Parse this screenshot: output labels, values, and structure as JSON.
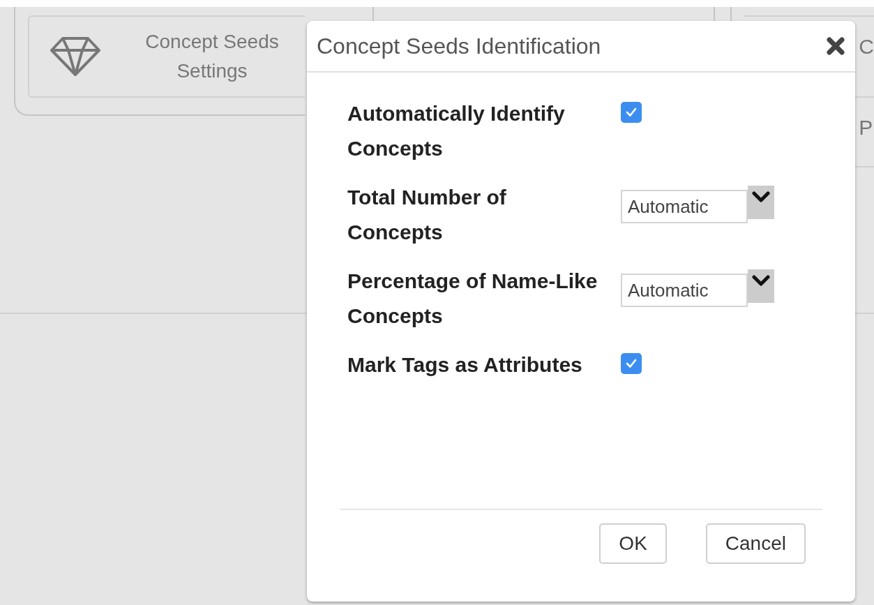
{
  "background": {
    "tile": {
      "label": "Concept Seeds Settings"
    },
    "right_tile": {
      "label": "C"
    },
    "right_item": {
      "label": "P"
    }
  },
  "dialog": {
    "title": "Concept Seeds Identification",
    "rows": [
      {
        "kind": "checkbox",
        "label": "Automatically Identify Concepts",
        "checked": true
      },
      {
        "kind": "select",
        "label": "Total Number of Concepts",
        "value": "Automatic"
      },
      {
        "kind": "select",
        "label": "Percentage of Name-Like Concepts",
        "value": "Automatic"
      },
      {
        "kind": "checkbox",
        "label": "Mark Tags as Attributes",
        "checked": true
      }
    ],
    "buttons": [
      "OK",
      "Cancel"
    ]
  }
}
